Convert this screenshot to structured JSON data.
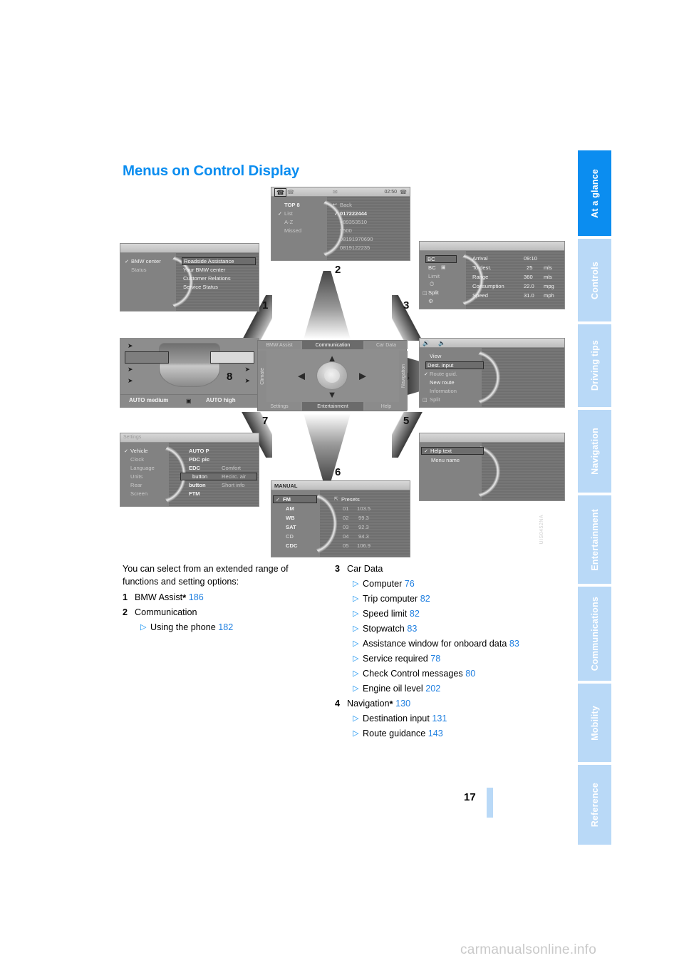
{
  "page": {
    "headline": "Menus on Control Display",
    "number": "17",
    "figure_id": "UIS0452NA",
    "watermark": "carmanualsonline.info"
  },
  "tabs": [
    {
      "label": "At a glance",
      "active": true
    },
    {
      "label": "Controls",
      "active": false
    },
    {
      "label": "Driving tips",
      "active": false
    },
    {
      "label": "Navigation",
      "active": false
    },
    {
      "label": "Entertainment",
      "active": false
    },
    {
      "label": "Communications",
      "active": false
    },
    {
      "label": "Mobility",
      "active": false
    },
    {
      "label": "Reference",
      "active": false
    }
  ],
  "colors": {
    "accent": "#0b8df0",
    "tab_inactive": "#b9d9f7",
    "page_ref": "#1f7fe0"
  },
  "intro": "You can select from an extended range of functions and setting options:",
  "list_left": [
    {
      "num": "1",
      "label": "BMW Assist",
      "asterisk": "*",
      "page": "186",
      "subs": []
    },
    {
      "num": "2",
      "label": "Communication",
      "asterisk": "",
      "page": "",
      "subs": [
        {
          "label": "Using the phone",
          "page": "182"
        }
      ]
    }
  ],
  "list_right": [
    {
      "num": "3",
      "label": "Car Data",
      "asterisk": "",
      "page": "",
      "subs": [
        {
          "label": "Computer",
          "page": "76"
        },
        {
          "label": "Trip computer",
          "page": "82"
        },
        {
          "label": "Speed limit",
          "page": "82"
        },
        {
          "label": "Stopwatch",
          "page": "83"
        },
        {
          "label": "Assistance window for onboard data",
          "page": "83"
        },
        {
          "label": "Service required",
          "page": "78"
        },
        {
          "label": "Check Control messages",
          "page": "80"
        },
        {
          "label": "Engine oil level",
          "page": "202"
        }
      ]
    },
    {
      "num": "4",
      "label": "Navigation",
      "asterisk": "*",
      "page": "130",
      "subs": [
        {
          "label": "Destination input",
          "page": "131"
        },
        {
          "label": "Route guidance",
          "page": "143"
        }
      ]
    }
  ],
  "figure": {
    "callouts": [
      "1",
      "2",
      "3",
      "4",
      "5",
      "6",
      "7",
      "8"
    ],
    "central": {
      "top": [
        "BMW Assist",
        "Communication",
        "Car Data"
      ],
      "left": "Climate",
      "right": "Navigation",
      "bottom": [
        "Settings",
        "Entertainment",
        "Help"
      ],
      "selected": "Communication"
    },
    "screens": {
      "bmw_assist": {
        "left": [
          "BMW center",
          "Status"
        ],
        "right": [
          "Roadside Assistance",
          "Your BMW center",
          "Customer Relations",
          "Service Status"
        ],
        "checked": "BMW center",
        "highlighted": "Roadside Assistance"
      },
      "communication": {
        "status_time": "02:50",
        "left": [
          "TOP 8",
          "List",
          "A-Z",
          "Missed"
        ],
        "checked": "List",
        "right_header": "Back",
        "right": [
          "017222444",
          "089353510",
          "5500",
          "08191970690",
          "0819122235"
        ],
        "right_checked": "017222444"
      },
      "car_data": {
        "left": [
          "BC",
          "BC",
          "Limit",
          "Split"
        ],
        "rows": [
          {
            "label": "Arrival",
            "value": "09:10",
            "unit": ""
          },
          {
            "label": "To dest.",
            "value": "25",
            "unit": "mls"
          },
          {
            "label": "Range",
            "value": "360",
            "unit": "mls"
          },
          {
            "label": "Consumption",
            "value": "22.0",
            "unit": "mpg"
          },
          {
            "label": "Speed",
            "value": "31.0",
            "unit": "mph"
          }
        ]
      },
      "navigation": {
        "items": [
          "View",
          "Dest. input",
          "Route guid.",
          "New route",
          "Information",
          "Split"
        ],
        "highlighted": "Dest. input",
        "checked": "Route guid."
      },
      "help": {
        "items": [
          "Help text",
          "Menu name"
        ],
        "checked": "Help text",
        "highlighted": "Help text"
      },
      "entertainment": {
        "title": "MANUAL",
        "left": [
          "FM",
          "AM",
          "WB",
          "SAT",
          "CD",
          "CDC"
        ],
        "checked": "FM",
        "right_header": "Presets",
        "presets": [
          {
            "no": "01",
            "freq": "103.5"
          },
          {
            "no": "02",
            "freq": "99.3"
          },
          {
            "no": "03",
            "freq": "92.3"
          },
          {
            "no": "04",
            "freq": "94.3"
          },
          {
            "no": "05",
            "freq": "106.9"
          }
        ]
      },
      "settings": {
        "title": "Settings",
        "left": [
          "Vehicle",
          "Clock",
          "Language",
          "Units",
          "Rear",
          "Screen"
        ],
        "checked": "Vehicle",
        "right": [
          {
            "label": "AUTO P",
            "value": ""
          },
          {
            "label": "PDC pic",
            "value": ""
          },
          {
            "label": "EDC",
            "value": "Comfort"
          },
          {
            "label": "button",
            "value": "Recirc. air"
          },
          {
            "label": "button",
            "value": "Short info"
          },
          {
            "label": "FTM",
            "value": ""
          }
        ],
        "highlighted": "button"
      },
      "climate": {
        "auto_left": "AUTO medium",
        "auto_right": "AUTO high"
      }
    }
  }
}
